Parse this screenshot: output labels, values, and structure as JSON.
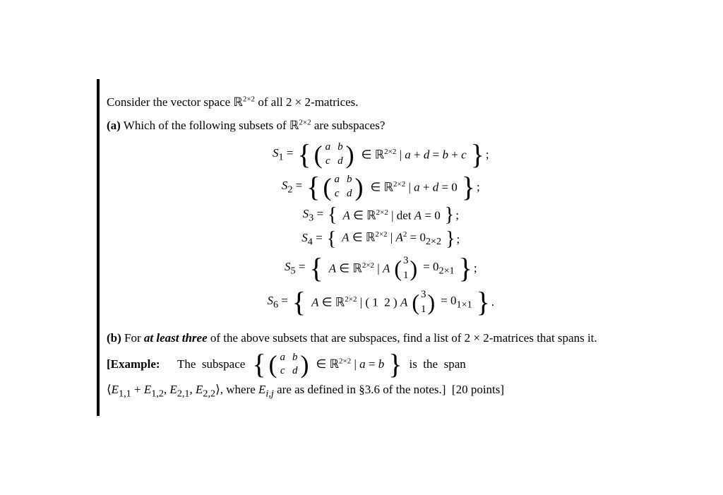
{
  "page": {
    "intro_line1": "Consider the vector space ℝ",
    "intro_sup1": "2×2",
    "intro_line1_rest": " of all 2 × 2-matrices.",
    "intro_line2_bold": "(a)",
    "intro_line2_rest": " Which of the following subsets of ℝ",
    "intro_sup2": "2×2",
    "intro_line2_end": " are subspaces?",
    "sets": [
      {
        "label": "S₁",
        "type": "matrix_set",
        "condition": "a + d = b + c",
        "semicolon": ";"
      },
      {
        "label": "S₂",
        "type": "matrix_set",
        "condition": "a + d = 0",
        "semicolon": ";"
      },
      {
        "label": "S₃",
        "type": "element_set",
        "condition": "det A = 0",
        "semicolon": ";"
      },
      {
        "label": "S₄",
        "type": "element_set",
        "condition": "A² = 0₂×₂",
        "semicolon": ";"
      },
      {
        "label": "S₅",
        "type": "colvec_set",
        "condition": "= 0₂×₁",
        "semicolon": ";"
      },
      {
        "label": "S₆",
        "type": "rowcolvec_set",
        "condition": "= 0₁×₁",
        "semicolon": "."
      }
    ],
    "part_b": {
      "label": "(b)",
      "text_before_bold": "For",
      "bold_text": "at least three",
      "text_after_bold": "of the above subsets that are subspaces, find a list of 2 × 2-matrices that spans it.",
      "example_label": "[Example:",
      "example_text1": "The  subspace",
      "example_condition": "a = b",
      "example_text2": "is  the  span",
      "last_line": "⟨E₁,₁ + E₁,₂, E₂,₁, E₂,₂⟩, where E",
      "last_subscript": "i,j",
      "last_rest": " are as defined in §3.6 of the notes.]  [20 points]"
    }
  }
}
